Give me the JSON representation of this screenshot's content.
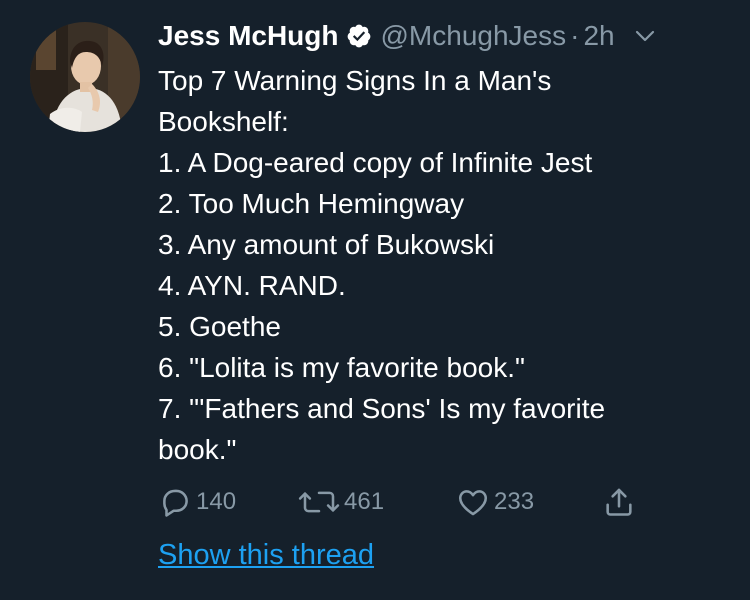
{
  "user": {
    "display_name": "Jess McHugh",
    "handle": "@MchughJess",
    "separator": "·",
    "time": "2h",
    "verified": true,
    "avatar_icon": "profile-photo"
  },
  "tweet": {
    "lines": [
      "Top 7 Warning Signs In a Man's",
      "Bookshelf:",
      "1. A Dog-eared copy of Infinite Jest",
      "2. Too Much Hemingway",
      "3. Any amount of Bukowski",
      "4. AYN. RAND.",
      "5. Goethe",
      "6. \"Lolita is my favorite book.\"",
      "7. \"'Fathers and Sons' Is my favorite",
      "book.\""
    ]
  },
  "actions": {
    "reply_count": "140",
    "retweet_count": "461",
    "like_count": "233"
  },
  "thread_link": "Show this thread",
  "colors": {
    "background": "#15202b",
    "secondary_text": "#8899a6",
    "link": "#1da1f2",
    "text": "#ffffff"
  }
}
